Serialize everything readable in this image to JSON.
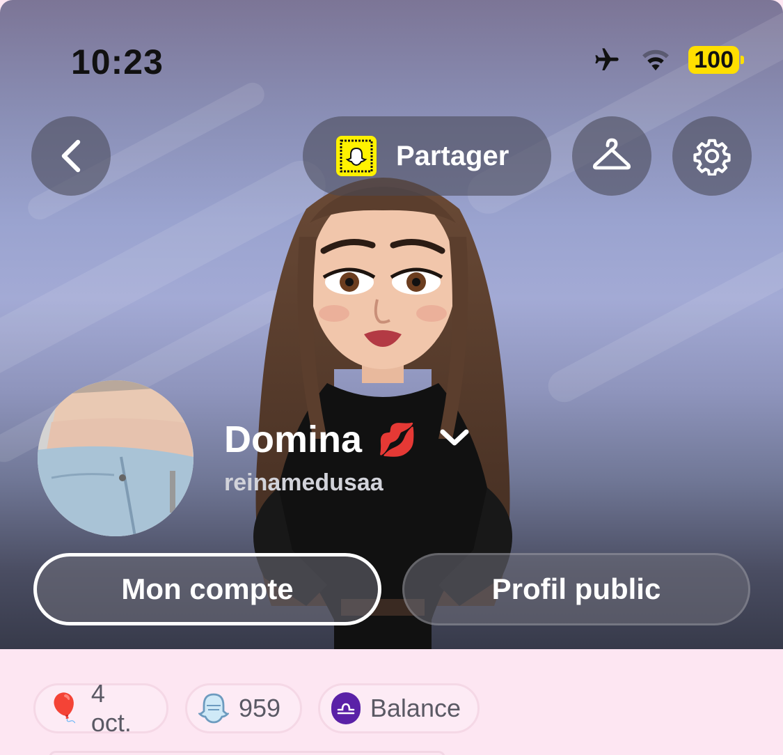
{
  "status_bar": {
    "time": "10:23",
    "battery": "100"
  },
  "header": {
    "share_label": "Partager"
  },
  "profile": {
    "display_name": "Domina",
    "display_name_emoji": "💋",
    "username": "reinamedusaa"
  },
  "buttons": {
    "account": "Mon compte",
    "public_profile": "Profil public"
  },
  "chips": [
    {
      "icon": "balloon-icon",
      "label": "4 oct."
    },
    {
      "icon": "snap-ghost-score-icon",
      "label": "959"
    },
    {
      "icon": "libra-icon",
      "label": "Balance"
    }
  ],
  "colors": {
    "accent": "#fff200",
    "background": "#fde6f2",
    "libra": "#5a21a7",
    "battery": "#ffdf00"
  },
  "icons": [
    "chevron-left-icon",
    "snapcode-icon",
    "hanger-icon",
    "gear-icon",
    "airplane-icon",
    "wifi-icon",
    "battery-icon",
    "chevron-down-icon"
  ]
}
